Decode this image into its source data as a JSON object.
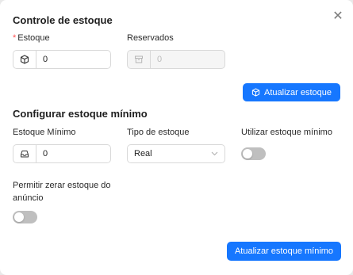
{
  "modal": {
    "close_glyph": "✕",
    "stock_section": {
      "title": "Controle de estoque",
      "stock_label": "Estoque",
      "required_mark": "*",
      "stock_value": "0",
      "reserved_label": "Reservados",
      "reserved_value": "0",
      "update_button": "Atualizar estoque"
    },
    "min_section": {
      "title": "Configurar estoque mínimo",
      "min_label": "Estoque Mínimo",
      "min_value": "0",
      "type_label": "Tipo de estoque",
      "type_value": "Real",
      "use_min_label": "Utilizar estoque mínimo",
      "use_min_enabled": false,
      "allow_zero_label_line1": "Permitir zerar estoque do",
      "allow_zero_label_line2": "anúncio",
      "allow_zero_enabled": false,
      "update_button": "Atualizar estoque mínimo"
    },
    "colors": {
      "primary": "#1677ff",
      "required": "#ff4d4f",
      "switch_off": "#bfbfbf"
    }
  }
}
